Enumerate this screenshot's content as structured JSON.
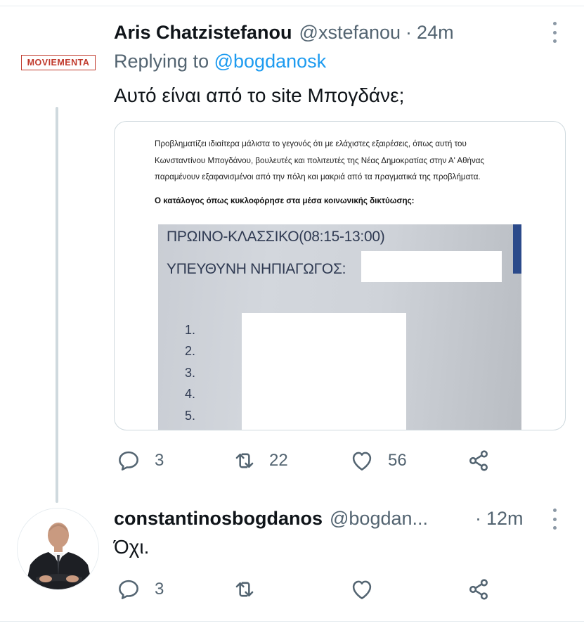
{
  "tweet1": {
    "avatar_logo_text": "MOVIEMENTA",
    "display_name": "Aris Chatzistefanou",
    "handle": "@xstefanou",
    "separator": "·",
    "time": "24m",
    "replying_prefix": "Replying to",
    "replying_handle": "@bogdanosk",
    "text": "Αυτό είναι από το site Μπογδάνε;",
    "media": {
      "article_lines": [
        "Προβληματίζει ιδιαίτερα μάλιστα το γεγονός ότι με ελάχιστες εξαιρέσεις, όπως αυτή του",
        "Κωνσταντίνου Μπογδάνου, βουλευτές και πολιτευτές της Νέας Δημοκρατίας στην Α' Αθήνας",
        "παραμένουν εξαφανισμένοι από την πόλη και μακριά από τα πραγματικά της προβλήματα."
      ],
      "article_bold": "Ο κατάλογος όπως κυκλοφόρησε στα μέσα κοινωνικής δικτύωσης:",
      "photo_line1": "ΠΡΩΙΝΟ-ΚΛΑΣΣΙΚΟ(08:15-13:00)",
      "photo_line2": "ΥΠΕΥΘΥΝΗ ΝΗΠΙΑΓΩΓΟΣ:",
      "list_numbers": [
        "1.",
        "2.",
        "3.",
        "4.",
        "5."
      ]
    },
    "actions": {
      "reply_count": "3",
      "retweet_count": "22",
      "like_count": "56"
    }
  },
  "tweet2": {
    "display_name": "constantinosbogdanos",
    "handle": "@bogdan...",
    "separator": "·",
    "time": "12m",
    "text": "Όχι.",
    "actions": {
      "reply_count": "3"
    }
  },
  "colors": {
    "text_primary": "#0f1419",
    "text_secondary": "#536471",
    "link": "#1d9bf0",
    "thread_line": "#cfd9de",
    "logo_red": "#c0392b"
  },
  "icons": [
    "more-icon",
    "reply-icon",
    "retweet-icon",
    "like-icon",
    "share-icon"
  ]
}
